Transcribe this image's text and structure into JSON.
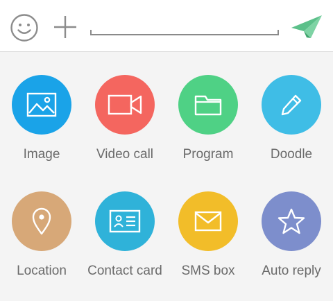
{
  "composer": {
    "emoji_icon": "smiley-icon",
    "plus_icon": "plus-icon",
    "input_value": "",
    "input_placeholder": "",
    "send_icon": "paper-plane-icon",
    "send_color": "#5cc08a"
  },
  "actions": [
    {
      "id": "image",
      "label": "Image",
      "icon": "image-icon",
      "color": "#1aa3e8"
    },
    {
      "id": "video-call",
      "label": "Video call",
      "icon": "video-camera-icon",
      "color": "#f4665f"
    },
    {
      "id": "program",
      "label": "Program",
      "icon": "folder-icon",
      "color": "#4fd185"
    },
    {
      "id": "doodle",
      "label": "Doodle",
      "icon": "pencil-icon",
      "color": "#3fbde6"
    },
    {
      "id": "location",
      "label": "Location",
      "icon": "map-pin-icon",
      "color": "#d7a878"
    },
    {
      "id": "contact-card",
      "label": "Contact card",
      "icon": "id-card-icon",
      "color": "#2fb2d9"
    },
    {
      "id": "sms-box",
      "label": "SMS box",
      "icon": "envelope-icon",
      "color": "#f2bd29"
    },
    {
      "id": "auto-reply",
      "label": "Auto reply",
      "icon": "star-icon",
      "color": "#7d8ecc"
    }
  ]
}
